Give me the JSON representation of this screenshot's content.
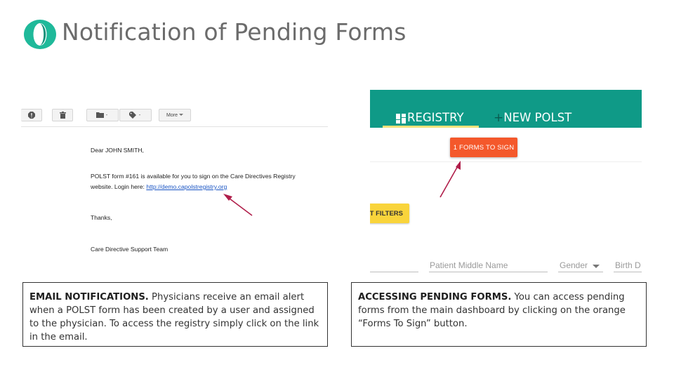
{
  "title": "Notification of Pending Forms",
  "colors": {
    "accent_green": "#1fb99a",
    "registry_teal": "#0f9a87",
    "forms_orange": "#f4582b",
    "filters_yellow": "#f9d43b",
    "arrow": "#b01e4a"
  },
  "email": {
    "toolbar": {
      "more_label": "More",
      "icons": [
        "report-spam-icon",
        "delete-icon",
        "folder-icon",
        "label-icon"
      ]
    },
    "greeting": "Dear JOHN SMITH,",
    "body_line1": "POLST form #161 is available for you to sign on the Care Directives Registry",
    "body_line2_prefix": "website. Login here: ",
    "link": "http://demo.capolstregistry.org",
    "thanks": "Thanks,",
    "signature": "Care Directive Support Team"
  },
  "registry": {
    "tab_registry": "REGISTRY",
    "tab_new_polst": "NEW POLST",
    "forms_button": "1 FORMS TO SIGN",
    "filters_button": "ET FILTERS",
    "fields": {
      "middle_name": "Patient Middle Name",
      "gender": "Gender",
      "birth": "Birth D"
    }
  },
  "captions": {
    "email_heading": "EMAIL NOTIFICATIONS.",
    "email_text": " Physicians receive an email alert when a POLST form has been created by a user and assigned to the physician. To access the registry simply click on the link in the email.",
    "forms_heading": "ACCESSING PENDING FORMS.",
    "forms_text": " You can access pending forms from the main dashboard by clicking on the orange “Forms To Sign” button."
  }
}
